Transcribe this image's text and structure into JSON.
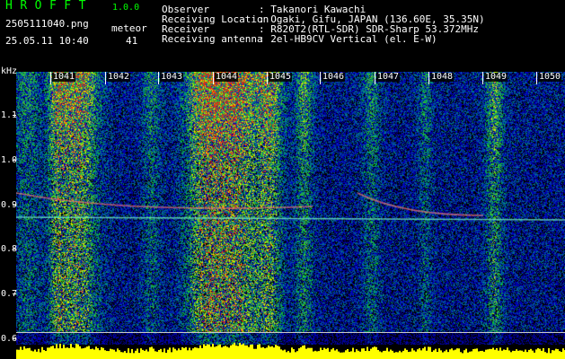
{
  "app": {
    "title": "HROFFT",
    "version": "1.0.0",
    "file_name": "2505111040.png",
    "timestamp": "25.05.11 10:40",
    "meteor_label": "meteor",
    "meteor_count": "41"
  },
  "info": {
    "rows": [
      {
        "label": "Observer",
        "value": ": Takanori Kawachi"
      },
      {
        "label": "Receiving Location",
        "value": ": Ogaki, Gifu, JAPAN (136.60E, 35.35N)"
      },
      {
        "label": "Receiver",
        "value": ": R820T2(RTL-SDR) SDR-Sharp 53.372MHz"
      },
      {
        "label": "Receiving antenna",
        "value": ": 2el-HB9CV Vertical (el. E-W)"
      }
    ]
  },
  "spectrogram": {
    "y_unit": "kHz",
    "y_labels": [
      "1.1",
      "1.0",
      "0.9",
      "0.8",
      "0.7",
      "0.6"
    ],
    "x_labels": [
      "1041",
      "1042",
      "1043",
      "1044",
      "1045",
      "1046",
      "1047",
      "1048",
      "1049",
      "1050"
    ],
    "colors": {
      "background": "#000000",
      "low": "#0000a0",
      "mid": "#00c000",
      "high": "#ffff00",
      "peak": "#ff0000",
      "level_bar": "#ffff00"
    }
  }
}
